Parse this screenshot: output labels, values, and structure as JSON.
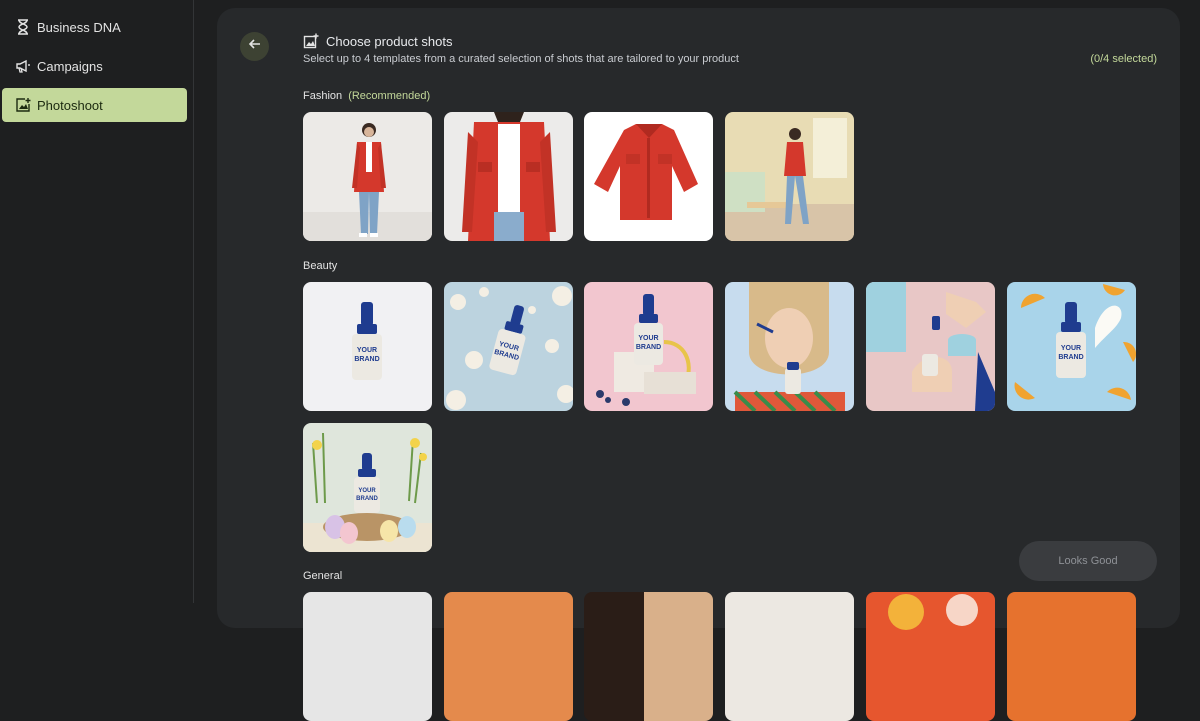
{
  "sidebar": {
    "items": [
      {
        "label": "Business DNA",
        "icon": "hourglass-icon"
      },
      {
        "label": "Campaigns",
        "icon": "megaphone-icon"
      },
      {
        "label": "Photoshoot",
        "icon": "add-photo-icon",
        "active": true
      }
    ]
  },
  "header": {
    "title": "Choose product shots",
    "subtitle": "Select up to 4 templates from a curated selection of shots that are tailored to your product",
    "counter": "(0/4 selected)"
  },
  "sections": {
    "fashion": {
      "label": "Fashion",
      "recommended": "(Recommended)"
    },
    "beauty": {
      "label": "Beauty"
    },
    "general": {
      "label": "General"
    }
  },
  "bottle_brand": {
    "line1": "YOUR",
    "line2": "BRAND"
  },
  "actions": {
    "looks_good": "Looks Good"
  },
  "colors": {
    "accent": "#c3d89a",
    "jacket": "#d4382c",
    "bottle_cap": "#1f3c8f"
  }
}
